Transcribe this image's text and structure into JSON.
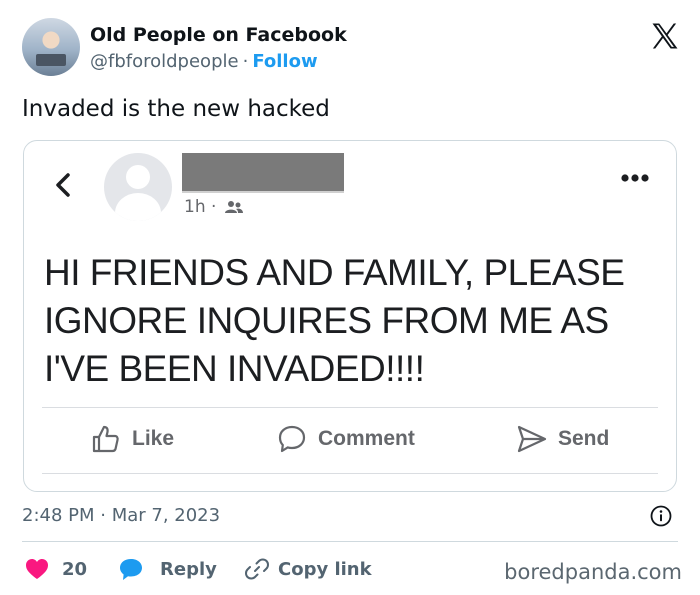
{
  "author": {
    "name": "Old People on Facebook",
    "handle": "@fbforoldpeople",
    "separator": "·",
    "follow_label": "Follow"
  },
  "tweet": {
    "text": "Invaded is the new hacked",
    "timestamp": "2:48 PM · Mar 7, 2023"
  },
  "embedded_post": {
    "time": "1h ·",
    "lines": [
      "HI FRIENDS AND FAMILY,  PLEASE",
      "IGNORE INQUIRES FROM ME AS",
      "I'VE BEEN INVADED!!!!"
    ],
    "actions": {
      "like": "Like",
      "comment": "Comment",
      "send": "Send"
    }
  },
  "footer": {
    "like_count": "20",
    "reply_label": "Reply",
    "copy_link_label": "Copy link"
  },
  "watermark": "boredpanda.com",
  "colors": {
    "accent": "#1d9bf0",
    "heart": "#f91880",
    "text": "#0f1419",
    "muted": "#536471"
  },
  "icons": [
    "x-logo-icon",
    "back-chevron-icon",
    "friends-icon",
    "more-dots-icon",
    "thumbs-up-icon",
    "comment-icon",
    "send-icon",
    "info-icon",
    "heart-icon",
    "reply-bubble-icon",
    "link-icon"
  ]
}
